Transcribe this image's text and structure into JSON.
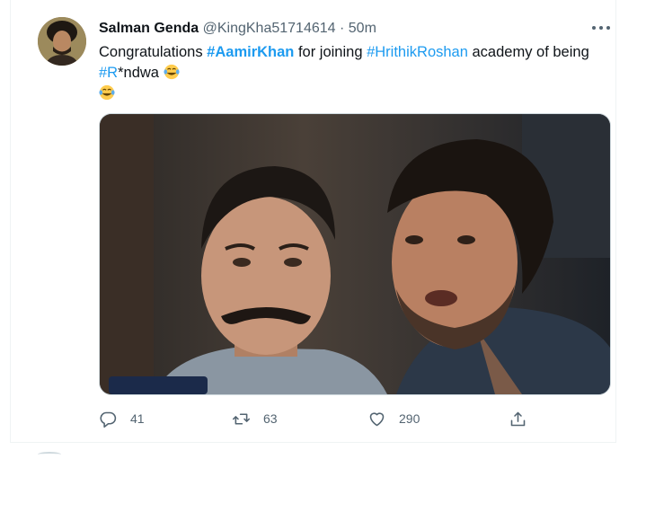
{
  "tweet": {
    "display_name": "Salman Genda",
    "handle": "@KingKha51714614",
    "separator": "·",
    "time": "50m",
    "text": {
      "part1": "Congratulations ",
      "hashtag1": "#AamirKhan",
      "part2": " for joining ",
      "hashtag2": "#HrithikRoshan",
      "part3": " academy of being ",
      "hashtag3": "#R",
      "part4": "*ndwa "
    },
    "emoji": "face-with-tears-of-joy",
    "media_alt": "Photo of Aamir Khan and Hrithik Roshan"
  },
  "actions": {
    "reply_count": "41",
    "retweet_count": "63",
    "like_count": "290"
  },
  "icons": {
    "more": "more-icon",
    "reply": "reply-icon",
    "retweet": "retweet-icon",
    "like": "heart-icon",
    "share": "share-icon"
  },
  "colors": {
    "link": "#1d9bf0",
    "secondary_text": "#536471",
    "primary_text": "#0f1419",
    "border": "#eff3f4"
  }
}
